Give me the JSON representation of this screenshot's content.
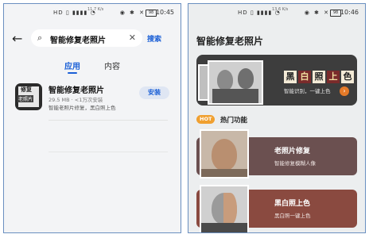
{
  "left": {
    "status": {
      "signals": "HD ▯ ▮▮▮▮ ◔",
      "speed": "11.7 K/s",
      "icons": "◉ ✱ ✕",
      "battery": "98",
      "time": "10:45"
    },
    "search": {
      "back": "←",
      "query": "智能修复老照片",
      "clear": "✕",
      "button": "搜索"
    },
    "tabs": [
      {
        "label": "应用"
      },
      {
        "label": "内容"
      }
    ],
    "app": {
      "icon_text_top": "修复",
      "icon_text_bottom": "老照片",
      "name": "智能修复老照片",
      "meta": "29.5 MB · <1万次安装",
      "desc": "智能老照片修复，黑白照上色",
      "install": "安装"
    }
  },
  "right": {
    "status": {
      "signals": "HD ▯ ▮▮▮▮ ◔",
      "speed": "13.6 K/s",
      "icons": "◉ ✱ ✕",
      "battery": "98",
      "time": "10:46"
    },
    "title": "智能修复老照片",
    "banner": {
      "chars": [
        "黑",
        "白",
        "照",
        "上",
        "色"
      ],
      "sub": "智能识别，一键上色",
      "go": "›"
    },
    "hot": {
      "badge": "HOT",
      "title": "热门功能"
    },
    "cards": [
      {
        "name": "老照片修复",
        "desc": "智能修复模糊人像"
      },
      {
        "name": "黑白照上色",
        "desc": "黑白照一键上色"
      }
    ]
  },
  "colors": {
    "accent": "#1a5fd6",
    "orange": "#e57a28",
    "card1": "#6b5050",
    "card2": "#8a4a40"
  }
}
